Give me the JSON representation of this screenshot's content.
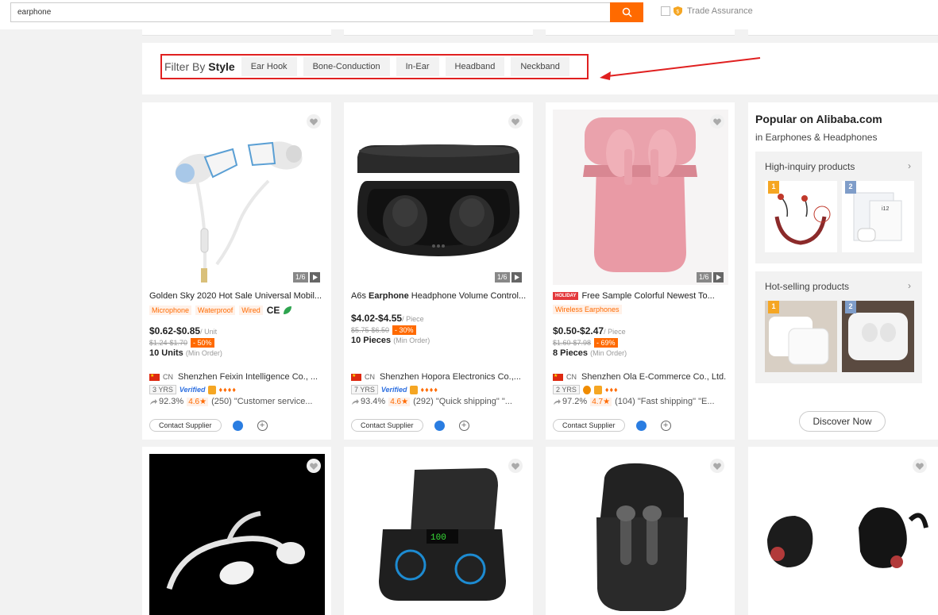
{
  "search": {
    "value": "earphone",
    "placeholder": ""
  },
  "trade_assurance": {
    "label": "Trade Assurance"
  },
  "filter": {
    "title_prefix": "Filter By",
    "title_bold": "Style",
    "chips": [
      "Ear Hook",
      "Bone-Conduction",
      "In-Ear",
      "Headband",
      "Neckband"
    ]
  },
  "products": [
    {
      "pager": "1/6",
      "title_pre": "",
      "title_bold": "",
      "title_post": "Golden Sky 2020 Hot Sale Universal Mobil...",
      "holiday": "",
      "tags": [
        "Microphone",
        "Waterproof",
        "Wired"
      ],
      "cert": "CE",
      "price": "$0.62-$0.85",
      "unit": "/ Unit",
      "orig_price": "$1.24-$1.70",
      "discount": "- 50%",
      "moq": "10 Units",
      "moq_note": "(Min Order)",
      "country": "CN",
      "supplier": "Shenzhen Feixin Intelligence Co., ...",
      "years": "3 YRS",
      "verified": "Verified",
      "response": "92.3%",
      "rating": "4.6★",
      "reviews": "(250)",
      "review_text": "\"Customer service...",
      "contact": "Contact Supplier"
    },
    {
      "pager": "1/6",
      "title_pre": "A6s ",
      "title_bold": "Earphone",
      "title_post": " Headphone Volume Control...",
      "holiday": "",
      "tags": [],
      "cert": "",
      "price": "$4.02-$4.55",
      "unit": "/ Piece",
      "orig_price": "$5.75-$6.50",
      "discount": "- 30%",
      "moq": "10 Pieces",
      "moq_note": "(Min Order)",
      "country": "CN",
      "supplier": "Shenzhen Hopora Electronics Co.,...",
      "years": "7 YRS",
      "verified": "Verified",
      "response": "93.4%",
      "rating": "4.6★",
      "reviews": "(292)",
      "review_text": "\"Quick shipping\"  \"...",
      "contact": "Contact Supplier"
    },
    {
      "pager": "1/6",
      "title_pre": "",
      "title_bold": "",
      "title_post": "Free Sample Colorful Newest To...",
      "holiday": "HOLIDAY",
      "tags": [
        "Wireless Earphones"
      ],
      "cert": "",
      "price": "$0.50-$2.47",
      "unit": "/ Piece",
      "orig_price": "$1.60-$7.98",
      "discount": "- 69%",
      "moq": "8 Pieces",
      "moq_note": "(Min Order)",
      "country": "CN",
      "supplier": "Shenzhen Ola E-Commerce Co., Ltd.",
      "years": "2 YRS",
      "verified": "",
      "response": "97.2%",
      "rating": "4.7★",
      "reviews": "(104)",
      "review_text": "\"Fast shipping\"  \"E...",
      "contact": "Contact Supplier"
    }
  ],
  "popular": {
    "title": "Popular on Alibaba.com",
    "subtitle": "in Earphones & Headphones",
    "high_inquiry": "High-inquiry products",
    "hot_selling": "Hot-selling products",
    "rank1": "1",
    "rank2": "2",
    "discover": "Discover Now"
  },
  "colors": {
    "accent": "#ff6a00",
    "highlight_red": "#e02020"
  }
}
